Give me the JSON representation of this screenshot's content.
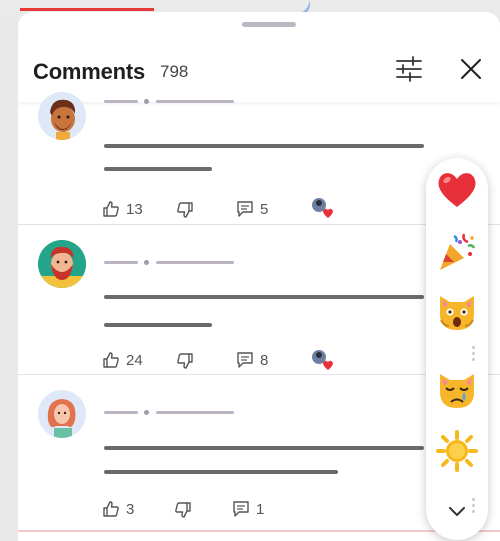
{
  "sheet": {
    "title": "Comments",
    "count": "798"
  },
  "header_icons": {
    "filter": "sliders-icon",
    "close": "close-icon"
  },
  "comments": [
    {
      "avatar": "avatar-bearded-man-brown",
      "likes": "13",
      "replies": "5",
      "reacted": "heart-reaction"
    },
    {
      "avatar": "avatar-bearded-man-red",
      "likes": "24",
      "replies": "8",
      "reacted": "heart-reaction"
    },
    {
      "avatar": "avatar-woman-red-hair",
      "likes": "3",
      "replies": "1",
      "reacted": ""
    }
  ],
  "reactions": [
    {
      "name": "heart-emoji",
      "glyph": "❤️"
    },
    {
      "name": "party-popper-emoji",
      "glyph": "🎉"
    },
    {
      "name": "weary-cat-emoji",
      "glyph": "🙀"
    },
    {
      "name": "crying-cat-emoji",
      "glyph": "😿"
    },
    {
      "name": "sun-emoji",
      "glyph": "☀️"
    }
  ],
  "colors": {
    "accent_red": "#e53935",
    "heart": "#e8303a",
    "sun": "#f7b81c",
    "cat": "#f7b52a"
  }
}
